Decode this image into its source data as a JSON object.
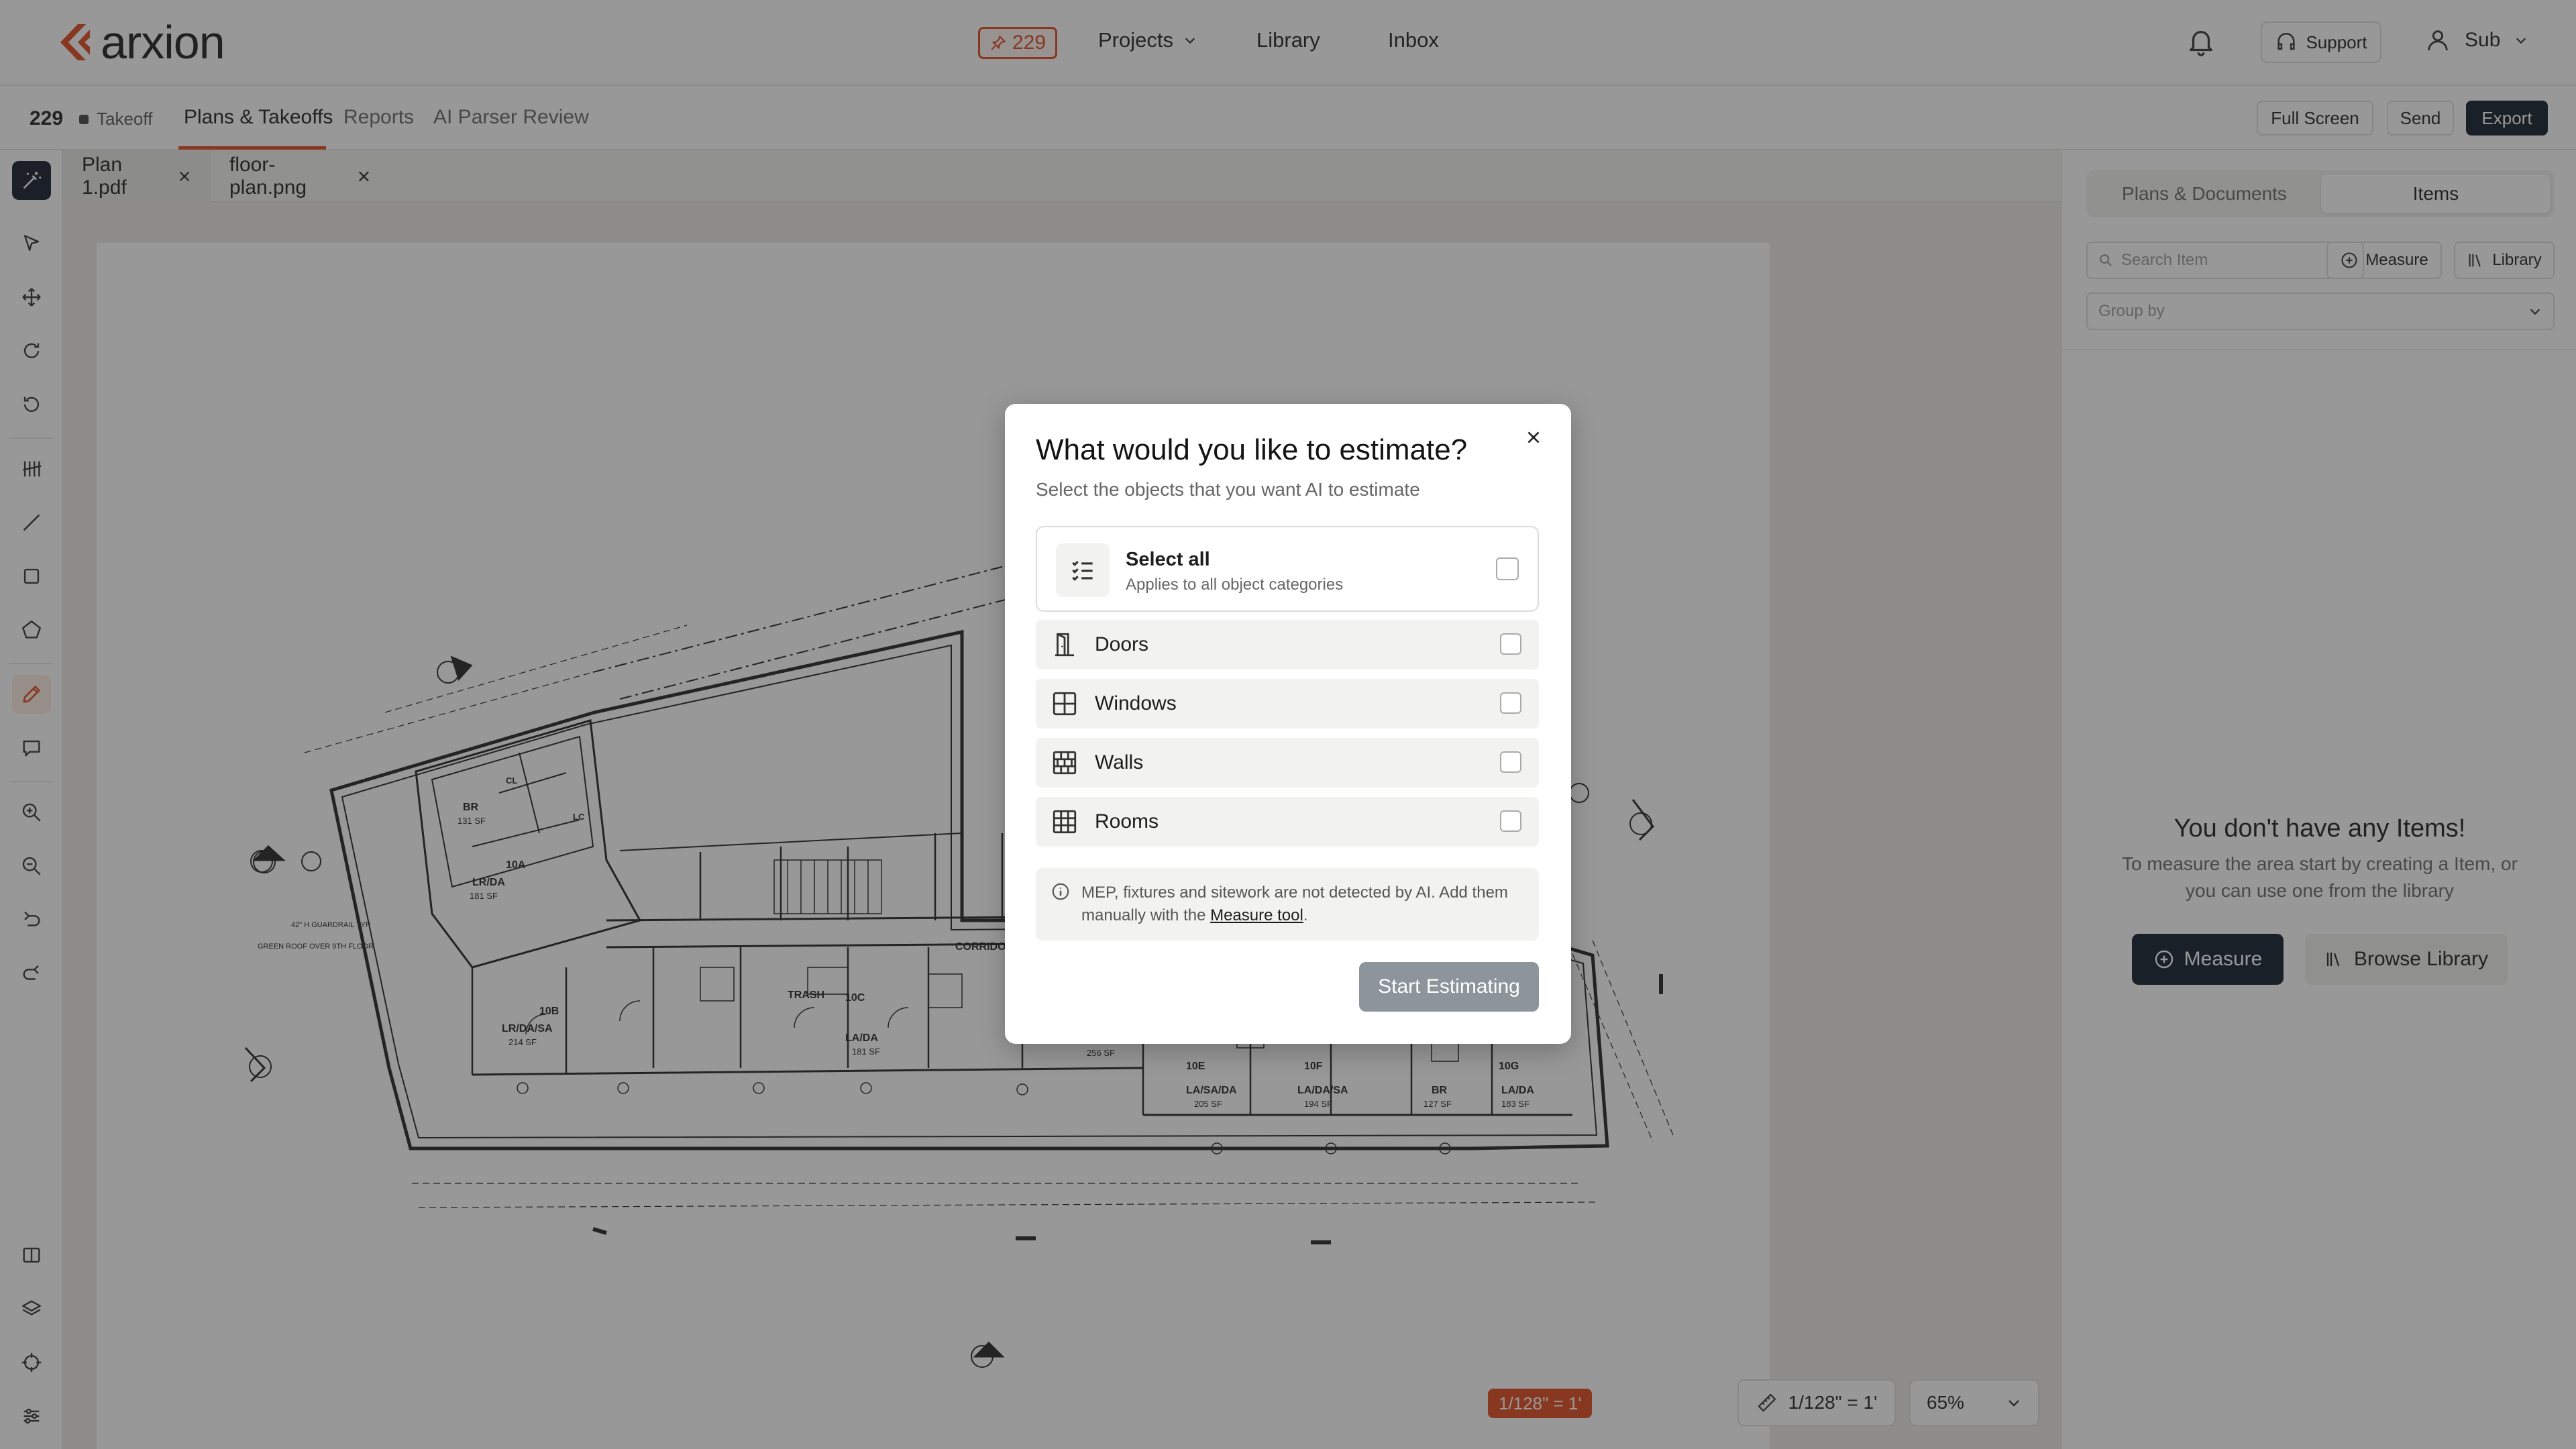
{
  "header": {
    "brand": "arxion",
    "project_badge": "229",
    "nav": [
      {
        "label": "Projects"
      },
      {
        "label": "Library"
      },
      {
        "label": "Inbox"
      }
    ],
    "support_label": "Support",
    "user_label": "Sub"
  },
  "subbar": {
    "project_id": "229",
    "status": "Takeoff",
    "tabs": [
      {
        "label": "Plans & Takeoffs"
      },
      {
        "label": "Reports"
      },
      {
        "label": "AI Parser Review"
      }
    ],
    "actions": {
      "fullscreen": "Full Screen",
      "send": "Send",
      "export": "Export"
    }
  },
  "files": {
    "tabs": [
      {
        "label": "Plan 1.pdf"
      },
      {
        "label": "floor-plan.png"
      }
    ]
  },
  "plan": {
    "labels": {
      "corridor": "CORRIDOR",
      "trash": "TRASH",
      "br": "BR",
      "cl": "CL",
      "lc": "LC",
      "r10a": "10A",
      "lr_da": "LR/DA",
      "sf181": "181 SF",
      "sf131": "131 SF",
      "r10b": "10B",
      "lr_da_sa": "LR/DA/SA",
      "sf214": "214 SF",
      "r10c": "10C",
      "la_da": "LA/DA",
      "sf181b": "181 SF",
      "r10e": "10E",
      "la_sa_da": "LA/SA/DA",
      "sf205": "205 SF",
      "r10f": "10F",
      "la_da_sa": "LA/DA/SA",
      "sf194": "194 SF",
      "br2": "BR",
      "sf127": "127 SF",
      "r10g": "10G",
      "la_da2": "LA/DA",
      "sf183": "183 SF",
      "sf256": "256 SF",
      "guardrail": "42\" H GUARDRAIL TYP",
      "roof": "GREEN ROOF OVER 9TH FLOOR"
    },
    "scale_tag": "1/128\" = 1'",
    "scale_value": "1/128\" = 1'",
    "zoom": "65%"
  },
  "right_panel": {
    "tabs": [
      {
        "label": "Plans & Documents"
      },
      {
        "label": "Items"
      }
    ],
    "search_placeholder": "Search Item",
    "measure_label": "Measure",
    "library_label": "Library",
    "groupby_placeholder": "Group by",
    "empty_title": "You don't have any Items!",
    "empty_desc": "To measure the area start by creating a Item, or you can use one from the library",
    "empty_measure": "Measure",
    "empty_browse": "Browse Library"
  },
  "modal": {
    "title": "What would you like to estimate?",
    "subtitle": "Select the objects that you want AI to estimate",
    "select_all_title": "Select all",
    "select_all_desc": "Applies to all object categories",
    "categories": [
      {
        "label": "Doors",
        "icon": "door-icon"
      },
      {
        "label": "Windows",
        "icon": "window-icon"
      },
      {
        "label": "Walls",
        "icon": "wall-icon"
      },
      {
        "label": "Rooms",
        "icon": "rooms-icon"
      }
    ],
    "note_text": "MEP, fixtures and sitework are not detected by AI. Add them manually with the ",
    "note_link": "Measure tool",
    "note_end": ".",
    "start_label": "Start Estimating"
  },
  "colors": {
    "accent": "#e0451a",
    "dark": "#0f1a2a",
    "disabled": "#8d949c"
  }
}
